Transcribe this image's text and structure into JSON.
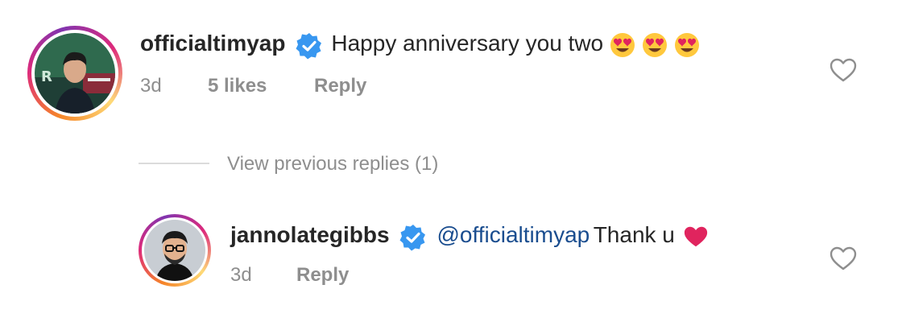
{
  "comment": {
    "username": "officialtimyap",
    "text": "Happy anniversary you two",
    "emoji_count": 3,
    "emoji_name": "heart-eyes-emoji",
    "time": "3d",
    "likes": "5 likes",
    "reply_label": "Reply"
  },
  "view_replies": {
    "label": "View previous replies (1)"
  },
  "reply": {
    "username": "jannolategibbs",
    "mention": "@officialtimyap",
    "text": "Thank u",
    "emoji_name": "red-heart-emoji",
    "time": "3d",
    "reply_label": "Reply"
  },
  "colors": {
    "verified": "#3897f0",
    "muted": "#8e8e8e",
    "mention": "#1a4d8f",
    "heart_red": "#e0245e"
  }
}
